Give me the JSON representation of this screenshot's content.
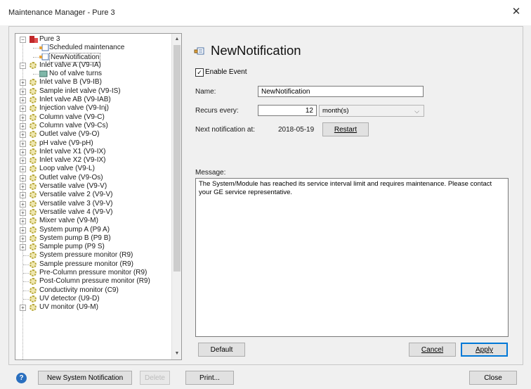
{
  "window": {
    "title": "Maintenance Manager - Pure 3",
    "close": "✕"
  },
  "tree": {
    "items": [
      {
        "label": "Pure 3",
        "level": 0,
        "expander": "−",
        "icon": "system-icon"
      },
      {
        "label": "Scheduled maintenance",
        "level": 1,
        "icon": "bell-icon"
      },
      {
        "label": "NewNotification",
        "level": 1,
        "icon": "bell-icon",
        "selected": true
      },
      {
        "label": "Inlet valve A (V9-IA)",
        "level": 0,
        "expander": "−",
        "icon": "gear-icon"
      },
      {
        "label": "No of valve turns",
        "level": 1,
        "icon": "counter-icon"
      },
      {
        "label": "Inlet valve B (V9-IB)",
        "level": 0,
        "expander": "+",
        "icon": "gear-icon"
      },
      {
        "label": "Sample inlet valve (V9-IS)",
        "level": 0,
        "expander": "+",
        "icon": "gear-icon"
      },
      {
        "label": "Inlet valve AB (V9-IAB)",
        "level": 0,
        "expander": "+",
        "icon": "gear-icon"
      },
      {
        "label": "Injection valve (V9-Inj)",
        "level": 0,
        "expander": "+",
        "icon": "gear-icon"
      },
      {
        "label": "Column valve (V9-C)",
        "level": 0,
        "expander": "+",
        "icon": "gear-icon"
      },
      {
        "label": "Column valve (V9-Cs)",
        "level": 0,
        "expander": "+",
        "icon": "gear-icon"
      },
      {
        "label": "Outlet valve (V9-O)",
        "level": 0,
        "expander": "+",
        "icon": "gear-icon"
      },
      {
        "label": "pH valve (V9-pH)",
        "level": 0,
        "expander": "+",
        "icon": "gear-icon"
      },
      {
        "label": "Inlet valve X1 (V9-IX)",
        "level": 0,
        "expander": "+",
        "icon": "gear-icon"
      },
      {
        "label": "Inlet valve X2 (V9-IX)",
        "level": 0,
        "expander": "+",
        "icon": "gear-icon"
      },
      {
        "label": "Loop valve (V9-L)",
        "level": 0,
        "expander": "+",
        "icon": "gear-icon"
      },
      {
        "label": "Outlet valve (V9-Os)",
        "level": 0,
        "expander": "+",
        "icon": "gear-icon"
      },
      {
        "label": "Versatile valve (V9-V)",
        "level": 0,
        "expander": "+",
        "icon": "gear-icon"
      },
      {
        "label": "Versatile valve 2 (V9-V)",
        "level": 0,
        "expander": "+",
        "icon": "gear-icon"
      },
      {
        "label": "Versatile valve 3 (V9-V)",
        "level": 0,
        "expander": "+",
        "icon": "gear-icon"
      },
      {
        "label": "Versatile valve 4 (V9-V)",
        "level": 0,
        "expander": "+",
        "icon": "gear-icon"
      },
      {
        "label": "Mixer valve (V9-M)",
        "level": 0,
        "expander": "+",
        "icon": "gear-icon"
      },
      {
        "label": "System pump A (P9 A)",
        "level": 0,
        "expander": "+",
        "icon": "gear-icon"
      },
      {
        "label": "System pump B (P9 B)",
        "level": 0,
        "expander": "+",
        "icon": "gear-icon"
      },
      {
        "label": "Sample pump (P9 S)",
        "level": 0,
        "expander": "+",
        "icon": "gear-icon"
      },
      {
        "label": "System pressure monitor (R9)",
        "level": 0,
        "icon": "gear-icon"
      },
      {
        "label": "Sample pressure monitor (R9)",
        "level": 0,
        "icon": "gear-icon"
      },
      {
        "label": "Pre-Column pressure monitor (R9)",
        "level": 0,
        "icon": "gear-icon"
      },
      {
        "label": "Post-Column pressure monitor (R9)",
        "level": 0,
        "icon": "gear-icon"
      },
      {
        "label": "Conductivity monitor (C9)",
        "level": 0,
        "icon": "gear-icon"
      },
      {
        "label": "UV detector (U9-D)",
        "level": 0,
        "icon": "gear-icon"
      },
      {
        "label": "UV monitor (U9-M)",
        "level": 0,
        "expander": "+",
        "icon": "gear-icon"
      }
    ]
  },
  "details": {
    "title": "NewNotification",
    "enable_event_label": "Enable Event",
    "enable_event_checked": true,
    "name_label": "Name:",
    "name_value": "NewNotification",
    "recurs_label": "Recurs every:",
    "recurs_value": "12",
    "recurs_unit": "month(s)",
    "next_label": "Next notification at:",
    "next_value": "2018-05-19",
    "restart_label": "Restart",
    "message_label": "Message:",
    "message_text": "The System/Module has reached its service interval limit and requires maintenance. Please contact your GE service representative.",
    "default_label": "Default",
    "cancel_label": "Cancel",
    "apply_label": "Apply"
  },
  "footer": {
    "new_system_notification": "New System Notification",
    "delete_label": "Delete",
    "print_label": "Print...",
    "close_label": "Close"
  }
}
